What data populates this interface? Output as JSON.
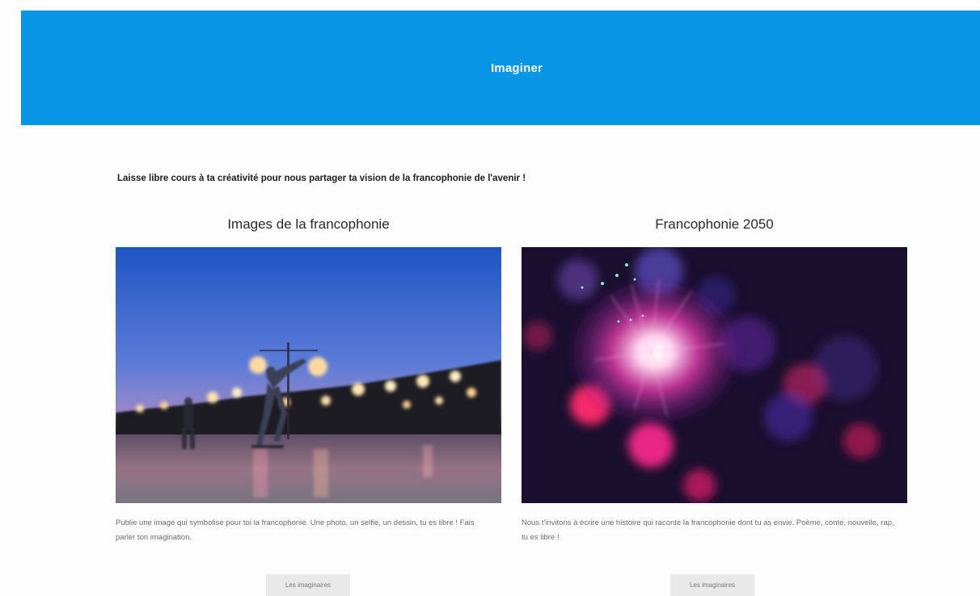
{
  "header": {
    "title": "Imaginer",
    "accent_color": "#0796e6"
  },
  "intro": {
    "text": "Laisse libre cours à ta créativité pour nous partager ta vision de la francophonie de l'avenir !"
  },
  "cards": [
    {
      "title": "Images de la francophonie",
      "description": "Publie une image qui symbolise pour toi la francophonie. Une photo, un selfie, un dessin, tu es libre ! Fais parler ton imagination.",
      "button_label": "Les imaginaires",
      "image_subject": "night-street-skateboarder-photo"
    },
    {
      "title": "Francophonie 2050",
      "description": "Nous t'invitons à écrire une histoire qui raconte la francophonie dont tu as envie. Poème, conte, nouvelle, rap, tu es libre !",
      "button_label": "Les imaginaires",
      "image_subject": "fiber-optic-bokeh-lights-photo"
    }
  ]
}
